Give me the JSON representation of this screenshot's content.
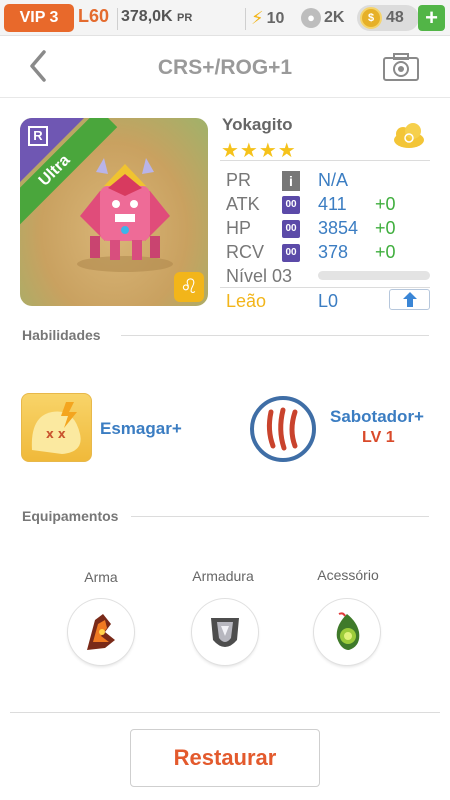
{
  "status_bar": {
    "vip": "VIP 3",
    "level": "L60",
    "power_value": "378,0K",
    "power_unit": "PR",
    "energy": "10",
    "paw_count": "2K",
    "coins": "48",
    "add_label": "+"
  },
  "header": {
    "title": "CRS+/ROG+1"
  },
  "monster": {
    "rarity": "Ultra",
    "rarity_badge": "R",
    "name": "Yokagito",
    "stars": "★★★★",
    "zodiac_symbol": "♌",
    "stats": {
      "pr_label": "PR",
      "pr_value": "N/A",
      "atk_label": "ATK",
      "atk_value": "411",
      "atk_bonus": "+0",
      "hp_label": "HP",
      "hp_value": "3854",
      "hp_bonus": "+0",
      "rcv_label": "RCV",
      "rcv_value": "378",
      "rcv_bonus": "+0",
      "box_text": "00",
      "info_text": "i"
    },
    "level_label": "Nível 03",
    "sign_label": "Leão",
    "sign_level": "L0"
  },
  "abilities": {
    "title": "Habilidades",
    "skill1_name": "Esmagar+",
    "skill2_name": "Sabotador+",
    "skill2_level": "LV 1"
  },
  "equipment": {
    "title": "Equipamentos",
    "weapon": "Arma",
    "armor": "Armadura",
    "accessory": "Acessório"
  },
  "restore_button": "Restaurar"
}
